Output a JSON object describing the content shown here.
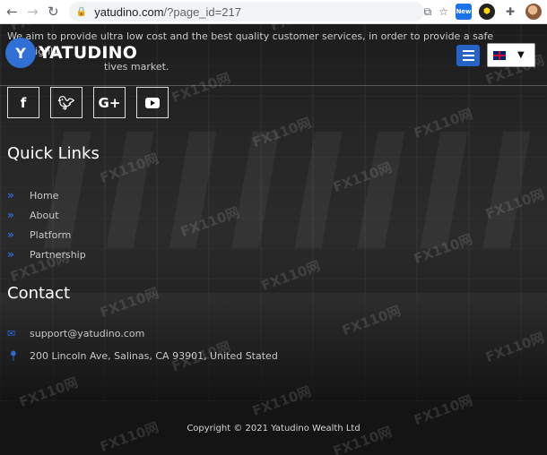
{
  "browser": {
    "url_host": "yatudino.com",
    "url_path": "/?page_id=217",
    "extension_badge": "New"
  },
  "site": {
    "tagline": "We aim to provide ultra low cost and the best quality customer services, in order to provide a safe and highly",
    "tagline_line2": "tives market.",
    "logo_text": "YATUDINO",
    "language_flag": "UK"
  },
  "social": [
    "facebook-icon",
    "twitter-icon",
    "google-plus-icon",
    "youtube-icon"
  ],
  "quick_links": {
    "heading": "Quick Links",
    "items": [
      "Home",
      "About",
      "Platform",
      "Partnership"
    ]
  },
  "contact": {
    "heading": "Contact",
    "email": "support@yatudino.com",
    "address": "200 Lincoln Ave, Salinas, CA 93901, United Stated"
  },
  "footer": {
    "copyright": "Copyright © 2021 Yatudino Wealth Ltd"
  },
  "watermark": "FX110网",
  "colors": {
    "accent": "#2563c9",
    "background": "#1a1a1a",
    "footer": "#141414"
  }
}
